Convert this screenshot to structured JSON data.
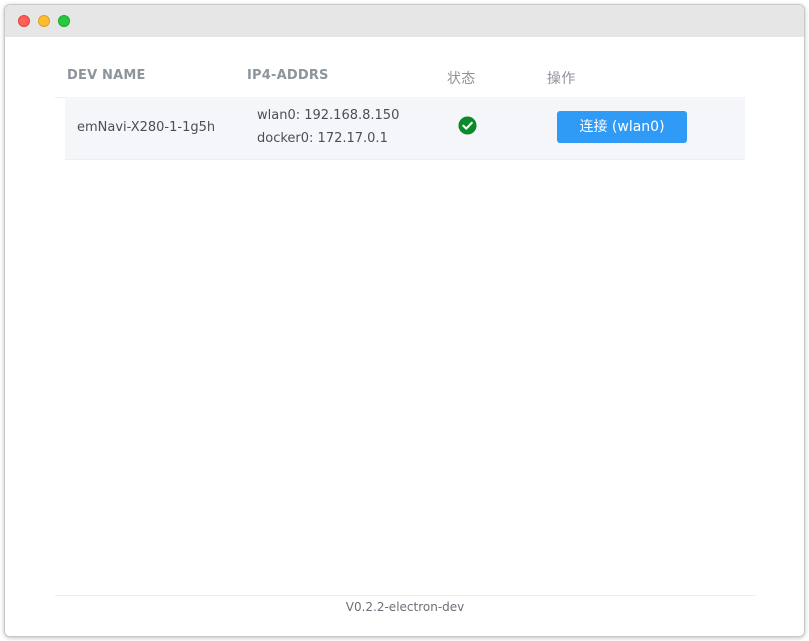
{
  "window": {
    "controls": [
      "close",
      "minimize",
      "maximize"
    ]
  },
  "table": {
    "headers": {
      "name": "DEV NAME",
      "ip": "IP4-ADDRS",
      "status": "状态",
      "action": "操作"
    },
    "rows": [
      {
        "name": "emNavi-X280-1-1g5h",
        "ip_lines": [
          "wlan0: 192.168.8.150",
          "docker0: 172.17.0.1"
        ],
        "status_icon": "check-circle-icon",
        "action_label": "连接 (wlan0)"
      }
    ]
  },
  "footer": {
    "version": "V0.2.2-electron-dev"
  },
  "colors": {
    "accent": "#2f9bf7",
    "status_ok": "#0b8a2a",
    "header_text": "#8e949c",
    "row_bg": "#f5f6f9"
  }
}
